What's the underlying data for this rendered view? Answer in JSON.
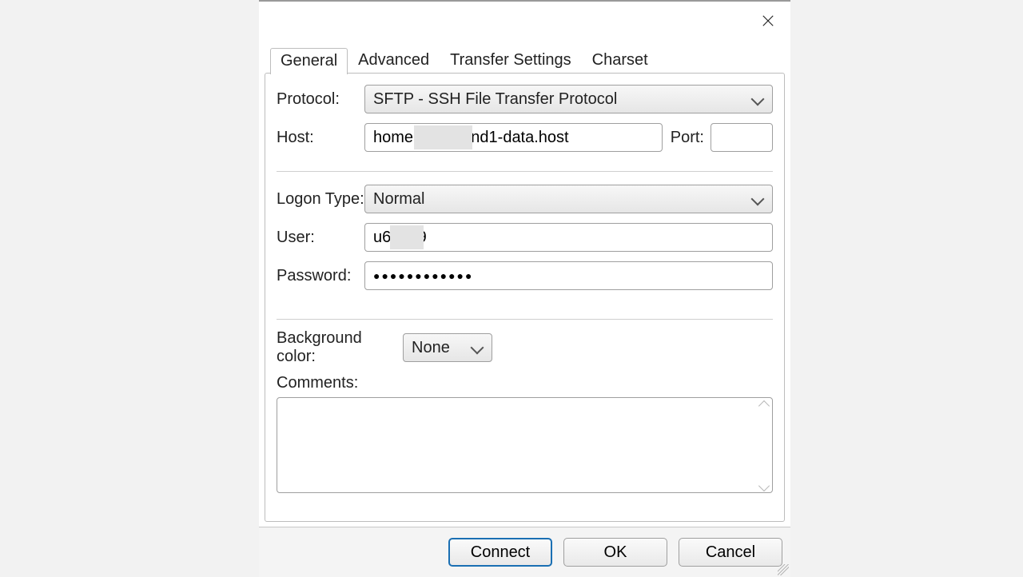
{
  "tabs": {
    "general": "General",
    "advanced": "Advanced",
    "transfer": "Transfer Settings",
    "charset": "Charset"
  },
  "labels": {
    "protocol": "Protocol:",
    "host": "Host:",
    "port": "Port:",
    "logon_type": "Logon Type:",
    "user": "User:",
    "password": "Password:",
    "bg_color": "Background color:",
    "comments": "Comments:"
  },
  "values": {
    "protocol": "SFTP - SSH File Transfer Protocol",
    "host": "home        .1and1-data.host",
    "port": "",
    "logon_type": "Normal",
    "user": "u6      9",
    "password": "●●●●●●●●●●●●",
    "bg_color": "None",
    "comments": ""
  },
  "buttons": {
    "connect": "Connect",
    "ok": "OK",
    "cancel": "Cancel"
  }
}
